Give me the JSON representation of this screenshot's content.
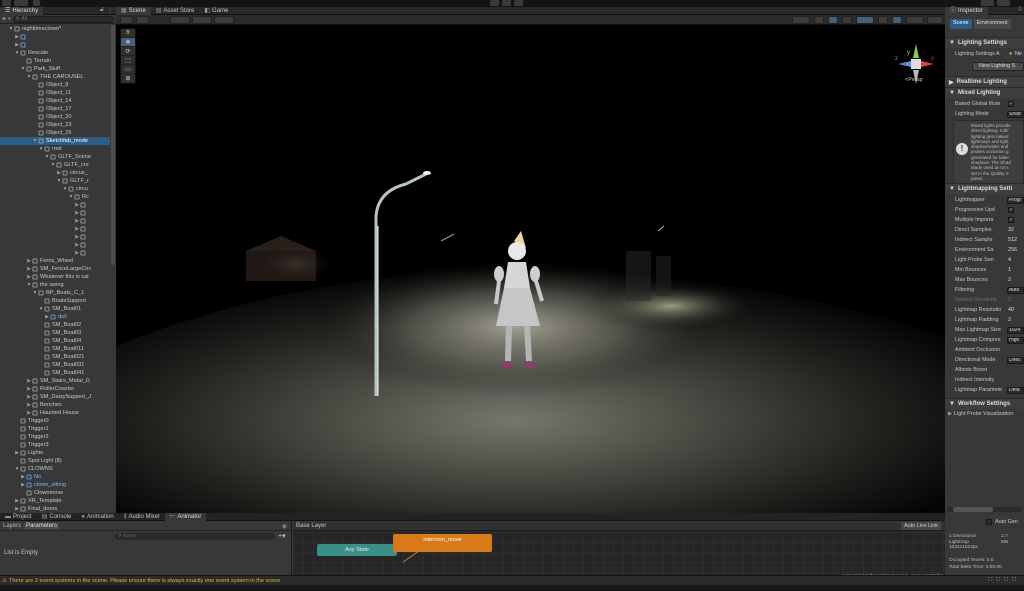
{
  "topbar": {
    "title": ""
  },
  "hierarchy": {
    "tab": "Hierarchy",
    "search_placeholder": "All",
    "add_label": "+",
    "items": [
      {
        "label": "nighttimeclown*",
        "indent": 0,
        "arrow": "▼",
        "icon": "unity-scene-icon",
        "kind": "root"
      },
      {
        "label": "",
        "indent": 1,
        "arrow": "▶",
        "icon": "cube-icon",
        "kind": "blue"
      },
      {
        "label": "",
        "indent": 1,
        "arrow": "▶",
        "icon": "cube-icon",
        "kind": "blue"
      },
      {
        "label": "Rescale",
        "indent": 1,
        "arrow": "▼",
        "icon": "cube-icon"
      },
      {
        "label": "Terrain",
        "indent": 2,
        "arrow": "",
        "icon": "cube-icon"
      },
      {
        "label": "Park_Stuff",
        "indent": 2,
        "arrow": "▼",
        "icon": "cube-icon"
      },
      {
        "label": "THE CAROUSEL",
        "indent": 3,
        "arrow": "▼",
        "icon": "cube-icon"
      },
      {
        "label": "Object_8",
        "indent": 4,
        "arrow": "",
        "icon": "cube-icon"
      },
      {
        "label": "Object_11",
        "indent": 4,
        "arrow": "",
        "icon": "cube-icon"
      },
      {
        "label": "Object_14",
        "indent": 4,
        "arrow": "",
        "icon": "cube-icon"
      },
      {
        "label": "Object_17",
        "indent": 4,
        "arrow": "",
        "icon": "cube-icon"
      },
      {
        "label": "Object_20",
        "indent": 4,
        "arrow": "",
        "icon": "cube-icon"
      },
      {
        "label": "Object_23",
        "indent": 4,
        "arrow": "",
        "icon": "cube-icon"
      },
      {
        "label": "Object_26",
        "indent": 4,
        "arrow": "",
        "icon": "cube-icon"
      },
      {
        "label": "Sketchfab_mode",
        "indent": 4,
        "arrow": "▼",
        "icon": "cube-icon",
        "kind": "sel"
      },
      {
        "label": "root",
        "indent": 5,
        "arrow": "▼",
        "icon": "cube-icon"
      },
      {
        "label": "GLTF_Scene",
        "indent": 6,
        "arrow": "▼",
        "icon": "cube-icon"
      },
      {
        "label": "GLTF_cre",
        "indent": 7,
        "arrow": "▼",
        "icon": "cube-icon"
      },
      {
        "label": "circus_",
        "indent": 8,
        "arrow": "▶",
        "icon": "cube-icon"
      },
      {
        "label": "GLTF_r",
        "indent": 8,
        "arrow": "▼",
        "icon": "cube-icon"
      },
      {
        "label": "circu",
        "indent": 9,
        "arrow": "▼",
        "icon": "cube-icon"
      },
      {
        "label": "Rc",
        "indent": 10,
        "arrow": "▼",
        "icon": "cube-icon"
      },
      {
        "label": "",
        "indent": 11,
        "arrow": "▶",
        "icon": "cube-icon"
      },
      {
        "label": "",
        "indent": 11,
        "arrow": "▶",
        "icon": "cube-icon"
      },
      {
        "label": "",
        "indent": 11,
        "arrow": "▶",
        "icon": "cube-icon"
      },
      {
        "label": "",
        "indent": 11,
        "arrow": "▶",
        "icon": "cube-icon"
      },
      {
        "label": "",
        "indent": 11,
        "arrow": "▶",
        "icon": "cube-icon"
      },
      {
        "label": "",
        "indent": 11,
        "arrow": "▶",
        "icon": "cube-icon"
      },
      {
        "label": "",
        "indent": 11,
        "arrow": "▶",
        "icon": "cube-icon"
      },
      {
        "label": "Ferris_Wheel",
        "indent": 3,
        "arrow": "▶",
        "icon": "cube-icon"
      },
      {
        "label": "SM_FenceLargeCirc",
        "indent": 3,
        "arrow": "▶",
        "icon": "cube-icon"
      },
      {
        "label": "Whatever this is cal",
        "indent": 3,
        "arrow": "▶",
        "icon": "cube-icon"
      },
      {
        "label": "the swing",
        "indent": 3,
        "arrow": "▼",
        "icon": "cube-icon"
      },
      {
        "label": "BP_Boats_C_1",
        "indent": 4,
        "arrow": "▼",
        "icon": "cube-icon"
      },
      {
        "label": "BoatsSupport",
        "indent": 5,
        "arrow": "",
        "icon": "cube-icon"
      },
      {
        "label": "SM_Boat01",
        "indent": 5,
        "arrow": "▼",
        "icon": "cube-icon"
      },
      {
        "label": "doll",
        "indent": 6,
        "arrow": "▶",
        "icon": "cube-icon",
        "kind": "blue"
      },
      {
        "label": "SM_Boat02",
        "indent": 5,
        "arrow": "",
        "icon": "cube-icon"
      },
      {
        "label": "SM_Boat03",
        "indent": 5,
        "arrow": "",
        "icon": "cube-icon"
      },
      {
        "label": "SM_Boat04",
        "indent": 5,
        "arrow": "",
        "icon": "cube-icon"
      },
      {
        "label": "SM_Boat011",
        "indent": 5,
        "arrow": "",
        "icon": "cube-icon"
      },
      {
        "label": "SM_Boat021",
        "indent": 5,
        "arrow": "",
        "icon": "cube-icon"
      },
      {
        "label": "SM_Boat031",
        "indent": 5,
        "arrow": "",
        "icon": "cube-icon"
      },
      {
        "label": "SM_Boat041",
        "indent": 5,
        "arrow": "",
        "icon": "cube-icon"
      },
      {
        "label": "SM_Stairs_Metal_0;",
        "indent": 3,
        "arrow": "▶",
        "icon": "cube-icon"
      },
      {
        "label": "RollerCoaster",
        "indent": 3,
        "arrow": "▶",
        "icon": "cube-icon"
      },
      {
        "label": "SM_DaisySupport_J",
        "indent": 3,
        "arrow": "▶",
        "icon": "cube-icon"
      },
      {
        "label": "Benches",
        "indent": 3,
        "arrow": "▶",
        "icon": "cube-icon"
      },
      {
        "label": "Haunted House",
        "indent": 3,
        "arrow": "▶",
        "icon": "cube-icon"
      },
      {
        "label": "Trigger0",
        "indent": 1,
        "arrow": "",
        "icon": "cube-icon"
      },
      {
        "label": "Trigger1",
        "indent": 1,
        "arrow": "",
        "icon": "cube-icon"
      },
      {
        "label": "Trigger2",
        "indent": 1,
        "arrow": "",
        "icon": "cube-icon"
      },
      {
        "label": "Trigger3",
        "indent": 1,
        "arrow": "",
        "icon": "cube-icon"
      },
      {
        "label": "Lights",
        "indent": 1,
        "arrow": "▶",
        "icon": "cube-icon"
      },
      {
        "label": "Spot Light (8)",
        "indent": 1,
        "arrow": "",
        "icon": "cube-icon"
      },
      {
        "label": "CLOWNS",
        "indent": 1,
        "arrow": "▼",
        "icon": "cube-icon"
      },
      {
        "label": "No",
        "indent": 2,
        "arrow": "▶",
        "icon": "cube-icon",
        "kind": "blue"
      },
      {
        "label": "clown_sitting",
        "indent": 2,
        "arrow": "▶",
        "icon": "cube-icon",
        "kind": "blue"
      },
      {
        "label": "Clownmove",
        "indent": 2,
        "arrow": "",
        "icon": "cube-icon"
      },
      {
        "label": "XR_Template",
        "indent": 1,
        "arrow": "▶",
        "icon": "cube-icon"
      },
      {
        "label": "Final_doors",
        "indent": 1,
        "arrow": "▶",
        "icon": "cube-icon"
      }
    ]
  },
  "scene": {
    "tabs": [
      {
        "label": "Scene",
        "icon": "grid-icon"
      },
      {
        "label": "Asset Store",
        "icon": "store-icon"
      },
      {
        "label": "Game",
        "icon": "gamepad-icon"
      }
    ],
    "persp_label": "<Persp",
    "gizmo": {
      "y": "y",
      "z": "z",
      "x": "x"
    }
  },
  "inspector": {
    "tabs": [
      "Inspector"
    ],
    "subtabs": [
      "Scene",
      "Environment"
    ],
    "lighting_settings_header": "Lighting Settings",
    "lighting_settings_label": "Lighting Settings A",
    "lighting_settings_value": "Ne",
    "new_lighting_btn": "New Lighting S",
    "realtime_header": "Realtime Lighting",
    "mixed_header": "Mixed Lighting",
    "baked_gi_label": "Baked Global Illum",
    "lighting_mode_label": "Lighting Mode",
    "lighting_mode_value": "Shad",
    "info_lines": [
      "Mixed lights provide",
      "direct lighting. Indir",
      "lighting gets baked",
      "lightmaps and light",
      "shadowmasks and",
      "probes occlusion g",
      "generated for bake",
      "shadows. The Shad",
      "Mode used at run t",
      "set in the Quality S",
      "panel."
    ],
    "lightmapping_header": "Lightmapping Setti",
    "rows": [
      {
        "label": "Lightmapper",
        "value": "Progr",
        "type": "box"
      },
      {
        "label": "Progressive Upd",
        "value": "✓",
        "type": "chk"
      },
      {
        "label": "Multiple Importa",
        "value": "✓",
        "type": "chk"
      },
      {
        "label": "Direct Samples",
        "value": "32",
        "type": "text"
      },
      {
        "label": "Indirect Sample",
        "value": "512",
        "type": "text"
      },
      {
        "label": "Environment Sa",
        "value": "256",
        "type": "text"
      },
      {
        "label": "Light Probe San",
        "value": "4",
        "type": "text"
      },
      {
        "label": "Min Bounces",
        "value": "1",
        "type": "text"
      },
      {
        "label": "Max Bounces",
        "value": "2",
        "type": "text"
      },
      {
        "label": "Filtering",
        "value": "Auto",
        "type": "box"
      },
      {
        "label": "Indirect Resolutio",
        "value": "2",
        "type": "grey"
      },
      {
        "label": "Lightmap Resolutio",
        "value": "40",
        "type": "text"
      },
      {
        "label": "Lightmap Padding",
        "value": "2",
        "type": "text"
      },
      {
        "label": "Max Lightmap Size",
        "value": "1024",
        "type": "box"
      },
      {
        "label": "Lightmap Compres",
        "value": "High",
        "type": "box"
      },
      {
        "label": "Ambient Occlusion",
        "value": "",
        "type": "text"
      },
      {
        "label": "Directional Mode",
        "value": "Direc",
        "type": "box"
      },
      {
        "label": "Albedo Boost",
        "value": "",
        "type": "text"
      },
      {
        "label": "Indirect Intensity",
        "value": "",
        "type": "text"
      },
      {
        "label": "Lightmap Paramete",
        "value": "Defa",
        "type": "box"
      }
    ],
    "workflow_header": "Workflow Settings",
    "probe_vis_label": "Light Probe Visualization",
    "auto_gen_label": "Auto Gen",
    "stats": {
      "line1": "1 Directional",
      "line2": "Lightmap",
      "line3": "1024x1024px",
      "size": "2.7",
      "unit": "MB",
      "occupied": "Occupied Texels: 0.0",
      "bake_time": "Total Bake Time: 0:00:00"
    }
  },
  "bottom": {
    "tabs": [
      {
        "label": "Project",
        "icon": "folder-icon"
      },
      {
        "label": "Console",
        "icon": "console-icon"
      },
      {
        "label": "Animation",
        "icon": "animation-icon"
      },
      {
        "label": "Audio Mixer",
        "icon": "audio-mixer-icon"
      },
      {
        "label": "Animator",
        "icon": "animator-icon"
      }
    ],
    "layers_label": "Layers",
    "params_label": "Parameters",
    "name_placeholder": "Name",
    "list_empty": "List is Empty",
    "base_layer": "Base Layer",
    "auto_live_link": "Auto Live Link",
    "any_state": "Any State",
    "intercom_move": "intercom_move",
    "path": "Animation/Hallway/interrogation_room.controller"
  },
  "status": {
    "warning": "There are 2 event systems in the scene. Please ensure there is always exactly one event system in the scene"
  },
  "colors": {
    "selection": "#2c5d87",
    "any_state": "#3a8f86",
    "intercom": "#d97a1a",
    "warning": "#e0b33a"
  }
}
